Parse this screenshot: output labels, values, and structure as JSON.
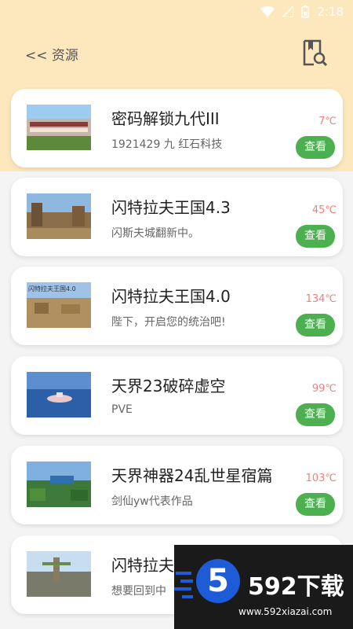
{
  "status_bar": {
    "time": "2:18",
    "icons": [
      "wifi-icon",
      "signal-icon",
      "battery-icon"
    ]
  },
  "header": {
    "back_label": "<< 资源",
    "search_icon": "book-search-icon"
  },
  "colors": {
    "top_band": "#fde7bc",
    "accent_green": "#4caf50",
    "temperature": "#f08080"
  },
  "items": [
    {
      "title": "密码解锁九代III",
      "subtitle": "1921429 九 红石科技",
      "temp": "7℃",
      "action": "查看"
    },
    {
      "title": "闪特拉夫王国4.3",
      "subtitle": "闪斯夫城翻新中。",
      "temp": "45℃",
      "action": "查看"
    },
    {
      "title": "闪特拉夫王国4.0",
      "subtitle": "陛下，开启您的统治吧!",
      "temp": "134℃",
      "action": "查看",
      "thumb_label": "闪特拉夫王国4.0"
    },
    {
      "title": "天界23破碎虚空",
      "subtitle": "PVE",
      "temp": "99℃",
      "action": "查看"
    },
    {
      "title": "天界神器24乱世星宿篇",
      "subtitle": "剑仙yw代表作品",
      "temp": "103℃",
      "action": "查看"
    },
    {
      "title": "闪特拉夫",
      "subtitle": "想要回到中",
      "temp": "",
      "action": ""
    }
  ],
  "watermark": {
    "badge": "5",
    "brand": "592下载",
    "url": "www.592xiazai.com"
  }
}
